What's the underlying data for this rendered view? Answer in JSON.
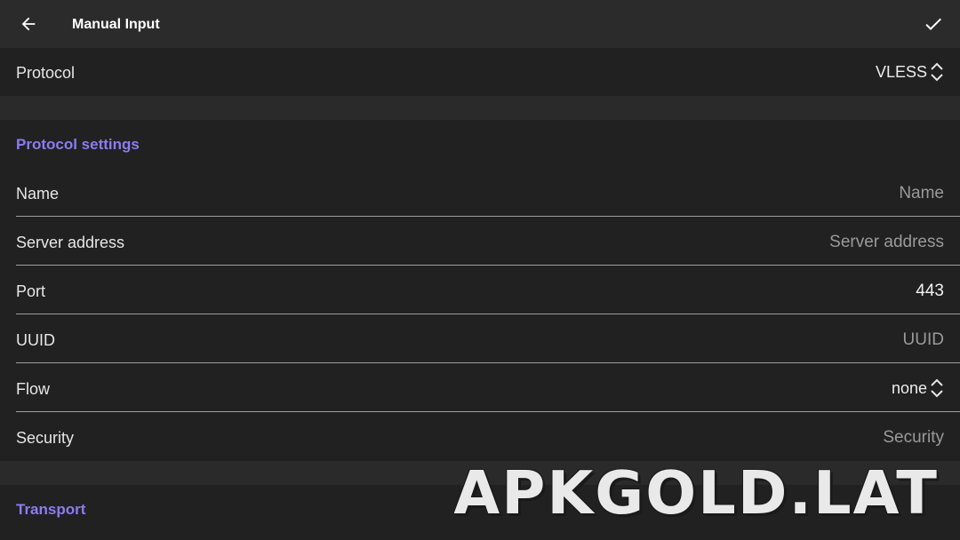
{
  "app_bar": {
    "back_icon": "arrow-back-icon",
    "title": "Manual Input",
    "confirm_icon": "check-icon"
  },
  "protocol_row": {
    "label": "Protocol",
    "value": "VLESS",
    "icon": "unfold-icon"
  },
  "protocol_settings": {
    "header": "Protocol settings",
    "fields": [
      {
        "label": "Name",
        "value": "",
        "placeholder": "Name"
      },
      {
        "label": "Server address",
        "value": "",
        "placeholder": "Server address"
      },
      {
        "label": "Port",
        "value": "443",
        "placeholder": ""
      },
      {
        "label": "UUID",
        "value": "",
        "placeholder": "UUID"
      },
      {
        "label": "Flow",
        "value": "none",
        "icon": "unfold-icon"
      },
      {
        "label": "Security",
        "value": "",
        "placeholder": "Security"
      }
    ]
  },
  "transport": {
    "header": "Transport"
  },
  "watermark": "APKGOLD.LAT",
  "colors": {
    "app_bar_bg": "#2b2b2b",
    "row_bg": "#212121",
    "separator_bg": "#2a2a2a",
    "accent": "#8c7cf0",
    "placeholder": "#9a9a9a",
    "divider": "#9e9e9e"
  }
}
